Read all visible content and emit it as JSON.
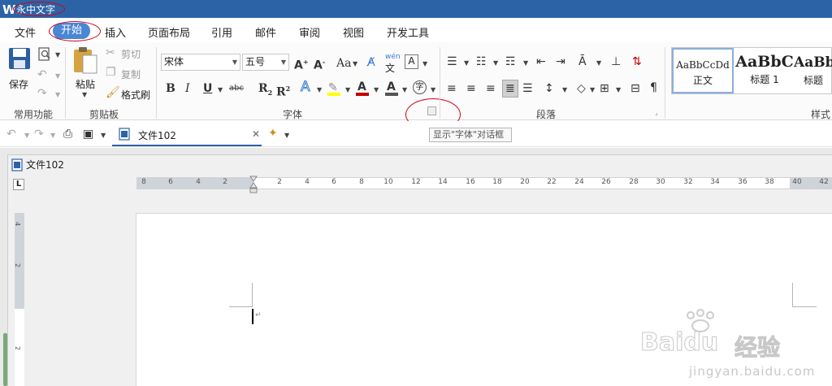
{
  "window": {
    "title": "永中文字"
  },
  "menu": {
    "tabs": [
      "文件",
      "开始",
      "插入",
      "页面布局",
      "引用",
      "邮件",
      "审阅",
      "视图",
      "开发工具"
    ],
    "active": "开始"
  },
  "ribbon": {
    "common": {
      "save": "保存",
      "group": "常用功能"
    },
    "clipboard": {
      "paste": "粘贴",
      "cut": "剪切",
      "copy": "复制",
      "format_painter": "格式刷",
      "group": "剪贴板"
    },
    "font": {
      "font_name": "宋体",
      "font_size": "五号",
      "aa": "Aa",
      "wen": "wén",
      "wen_char": "文",
      "grow": "A",
      "shrink": "A",
      "bold": "B",
      "italic": "I",
      "underline": "U",
      "strike": "abc",
      "subscript": "R",
      "superscript": "R",
      "sub_mark": "2",
      "sup_mark": "2",
      "text_effect": "A",
      "font_color": "A",
      "char_shade": "A",
      "enclose": "字",
      "group": "字体"
    },
    "paragraph": {
      "group": "段落"
    },
    "styles": {
      "items": [
        {
          "sample": "AaBbCcDd",
          "name": "正文"
        },
        {
          "sample": "AaBbC",
          "name": "标题 1"
        },
        {
          "sample": "AaBb",
          "name": "标题"
        }
      ],
      "group": "样式"
    }
  },
  "tooltip": "显示\"字体\"对话框",
  "doc_tab": {
    "title": "文件102"
  },
  "doc_window": {
    "title": "文件102"
  },
  "ruler": {
    "left_ticks": [
      "8",
      "6",
      "4",
      "2"
    ],
    "right_ticks": [
      "2",
      "4",
      "6",
      "8",
      "10",
      "12",
      "14",
      "16",
      "18",
      "20",
      "22",
      "24",
      "26",
      "28",
      "30",
      "32",
      "34",
      "36",
      "38",
      "40",
      "42"
    ],
    "vertical_ticks": [
      "4",
      "2",
      "2"
    ],
    "corner": "L"
  },
  "watermark": {
    "brand": "Baidu",
    "cn": "经验",
    "url": "jingyan.baidu.com"
  },
  "colors": {
    "accent": "#2b63a6",
    "active_tab": "#4a86d4",
    "annotation": "#d0021b",
    "font_color_bar": "#c00000",
    "highlight_bar": "#ffff00"
  }
}
